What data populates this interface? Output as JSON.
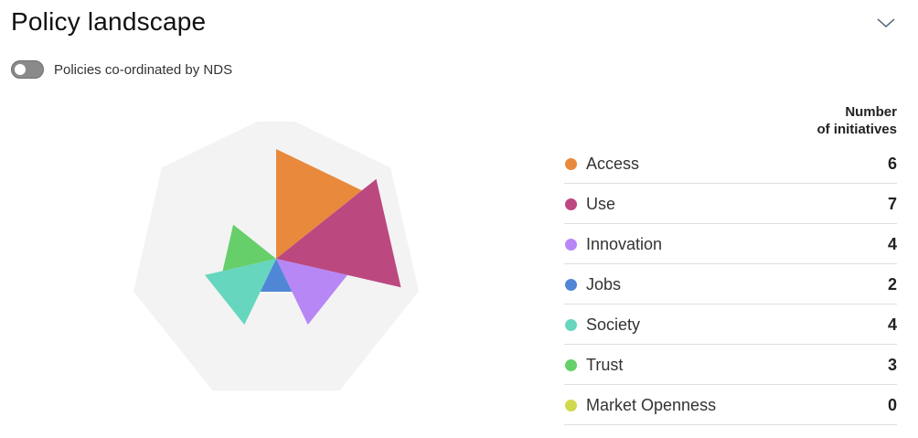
{
  "header": {
    "title": "Policy landscape",
    "collapse_icon": "chevron-down-icon"
  },
  "toggle": {
    "label": "Policies co-ordinated by NDS",
    "on": false
  },
  "legend": {
    "header_line1": "Number",
    "header_line2": "of initiatives"
  },
  "chart_data": {
    "type": "radial-polygon",
    "max_value": 8,
    "background_color": "#f3f3f3",
    "categories": [
      {
        "label": "Access",
        "value": 6,
        "color": "#e8893c"
      },
      {
        "label": "Use",
        "value": 7,
        "color": "#bc4880"
      },
      {
        "label": "Innovation",
        "value": 4,
        "color": "#b787f5"
      },
      {
        "label": "Jobs",
        "value": 2,
        "color": "#4f87d6"
      },
      {
        "label": "Society",
        "value": 4,
        "color": "#66d6be"
      },
      {
        "label": "Trust",
        "value": 3,
        "color": "#66cf6a"
      },
      {
        "label": "Market Openness",
        "value": 0,
        "color": "#d0d94d"
      }
    ]
  }
}
